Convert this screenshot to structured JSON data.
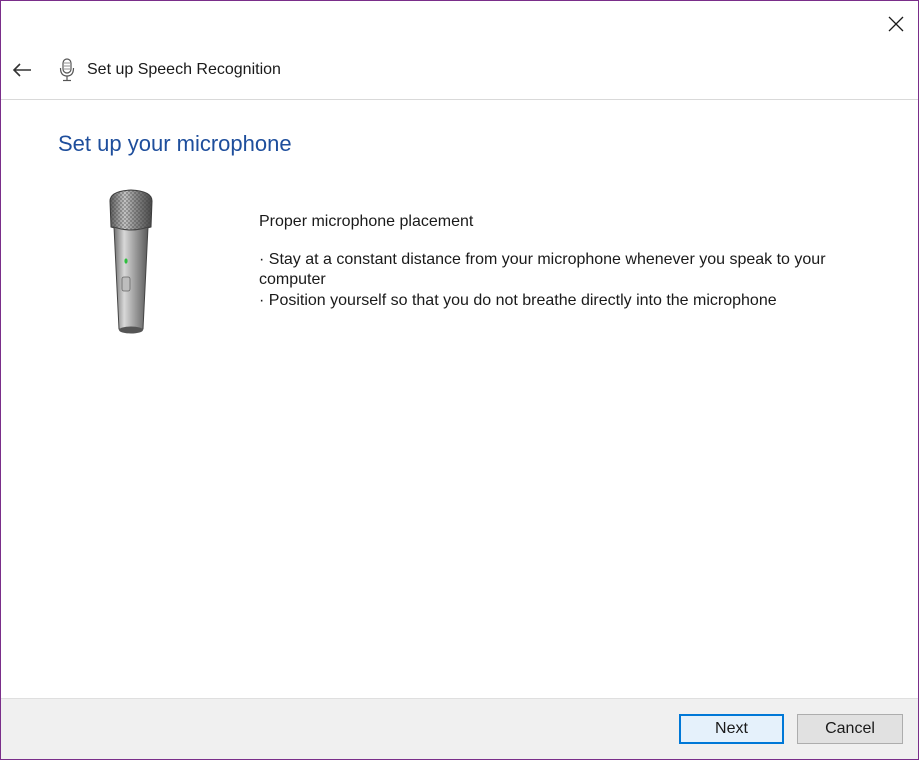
{
  "window": {
    "title": "Set up Speech Recognition"
  },
  "header": {
    "back_icon": "arrow-left-icon",
    "app_icon": "microphone-icon"
  },
  "main": {
    "heading": "Set up your microphone",
    "illustration": "handheld-microphone",
    "subheading": "Proper microphone placement",
    "tips": [
      "· Stay at a constant distance from your microphone whenever you speak to your computer",
      "· Position yourself so that you do not breathe directly into the microphone"
    ]
  },
  "footer": {
    "next_label": "Next",
    "cancel_label": "Cancel"
  },
  "colors": {
    "heading": "#1e4e9c",
    "accent_border": "#0078d7",
    "window_border": "#7a2e8a",
    "footer_bg": "#f0f0f0"
  }
}
